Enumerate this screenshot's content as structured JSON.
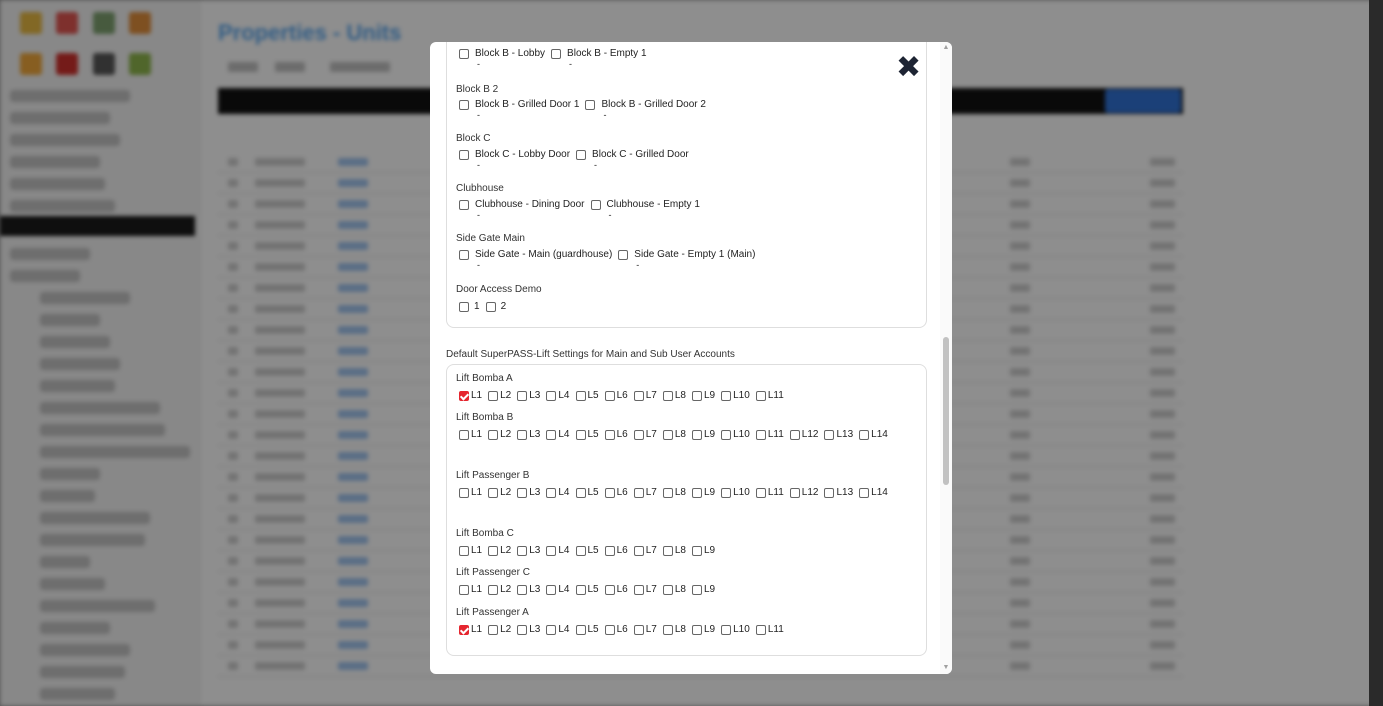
{
  "background": {
    "app_title": "Properties - Units"
  },
  "modal": {
    "close_glyph": "✖",
    "door_groups": [
      {
        "name": "",
        "doors": [
          {
            "label": "Block B - Lobby",
            "sub": "-",
            "checked": false
          },
          {
            "label": "Block B - Empty 1",
            "sub": "-",
            "checked": false
          }
        ]
      },
      {
        "name": "Block B 2",
        "doors": [
          {
            "label": "Block B - Grilled Door 1",
            "sub": "-",
            "checked": false
          },
          {
            "label": "Block B - Grilled Door 2",
            "sub": "-",
            "checked": false
          }
        ]
      },
      {
        "name": "Block C",
        "doors": [
          {
            "label": "Block C - Lobby Door",
            "sub": "-",
            "checked": false
          },
          {
            "label": "Block C - Grilled Door",
            "sub": "-",
            "checked": false
          }
        ]
      },
      {
        "name": "Clubhouse",
        "doors": [
          {
            "label": "Clubhouse - Dining Door",
            "sub": "-",
            "checked": false
          },
          {
            "label": "Clubhouse - Empty 1",
            "sub": "-",
            "checked": false
          }
        ]
      },
      {
        "name": "Side Gate Main",
        "doors": [
          {
            "label": "Side Gate - Main (guardhouse)",
            "sub": "-",
            "checked": false
          },
          {
            "label": "Side Gate - Empty 1 (Main)",
            "sub": "-",
            "checked": false
          }
        ]
      },
      {
        "name": "Door Access Demo",
        "doors": [
          {
            "label": "1",
            "checked": false
          },
          {
            "label": "2",
            "checked": false
          }
        ]
      }
    ],
    "lift_section_title": "Default SuperPASS-Lift Settings for Main and Sub User Accounts",
    "lift_groups": [
      {
        "name": "Lift Bomba A",
        "levels": [
          "L1",
          "L2",
          "L3",
          "L4",
          "L5",
          "L6",
          "L7",
          "L8",
          "L9",
          "L10",
          "L11"
        ],
        "checked": [
          "L1"
        ]
      },
      {
        "name": "Lift Bomba B",
        "levels": [
          "L1",
          "L2",
          "L3",
          "L4",
          "L5",
          "L6",
          "L7",
          "L8",
          "L9",
          "L10",
          "L11",
          "L12",
          "L13",
          "L14"
        ],
        "checked": []
      },
      {
        "name": "Lift Passenger B",
        "levels": [
          "L1",
          "L2",
          "L3",
          "L4",
          "L5",
          "L6",
          "L7",
          "L8",
          "L9",
          "L10",
          "L11",
          "L12",
          "L13",
          "L14"
        ],
        "checked": []
      },
      {
        "name": "Lift Bomba C",
        "levels": [
          "L1",
          "L2",
          "L3",
          "L4",
          "L5",
          "L6",
          "L7",
          "L8",
          "L9"
        ],
        "checked": []
      },
      {
        "name": "Lift Passenger C",
        "levels": [
          "L1",
          "L2",
          "L3",
          "L4",
          "L5",
          "L6",
          "L7",
          "L8",
          "L9"
        ],
        "checked": []
      },
      {
        "name": "Lift Passenger A",
        "levels": [
          "L1",
          "L2",
          "L3",
          "L4",
          "L5",
          "L6",
          "L7",
          "L8",
          "L9",
          "L10",
          "L11"
        ],
        "checked": [
          "L1"
        ]
      }
    ]
  }
}
